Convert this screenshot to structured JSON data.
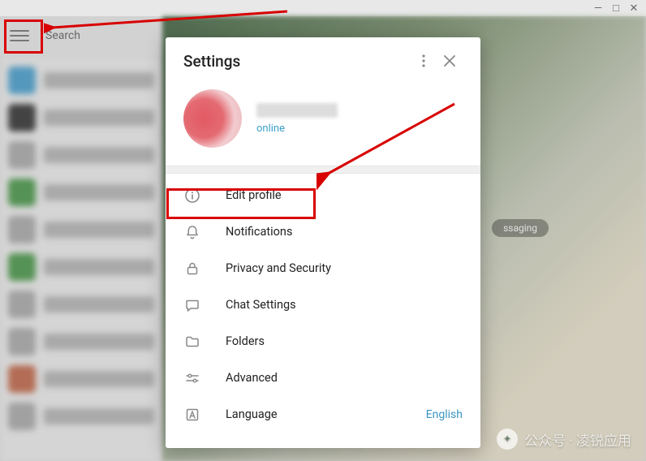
{
  "window_controls": {
    "minimize": "—",
    "maximize": "□",
    "close": "✕"
  },
  "header": {
    "search_placeholder": "Search"
  },
  "main": {
    "chip_text": "ssaging"
  },
  "settings": {
    "title": "Settings",
    "profile": {
      "status": "online"
    },
    "items": [
      {
        "icon": "info-icon",
        "label": "Edit profile"
      },
      {
        "icon": "bell-icon",
        "label": "Notifications"
      },
      {
        "icon": "lock-icon",
        "label": "Privacy and Security"
      },
      {
        "icon": "chat-icon",
        "label": "Chat Settings"
      },
      {
        "icon": "folder-icon",
        "label": "Folders"
      },
      {
        "icon": "sliders-icon",
        "label": "Advanced"
      },
      {
        "icon": "language-icon",
        "label": "Language",
        "value": "English"
      }
    ]
  },
  "watermark": {
    "text": "公众号 · 凌锐应用"
  },
  "sidebar_colors": [
    "#4aa5d6",
    "#333",
    "#b0b0b0",
    "#4a9c4a",
    "#b0b0b0",
    "#4a9c4a",
    "#b0b0b0",
    "#b0b0b0",
    "#c86a4a",
    "#b0b0b0"
  ]
}
